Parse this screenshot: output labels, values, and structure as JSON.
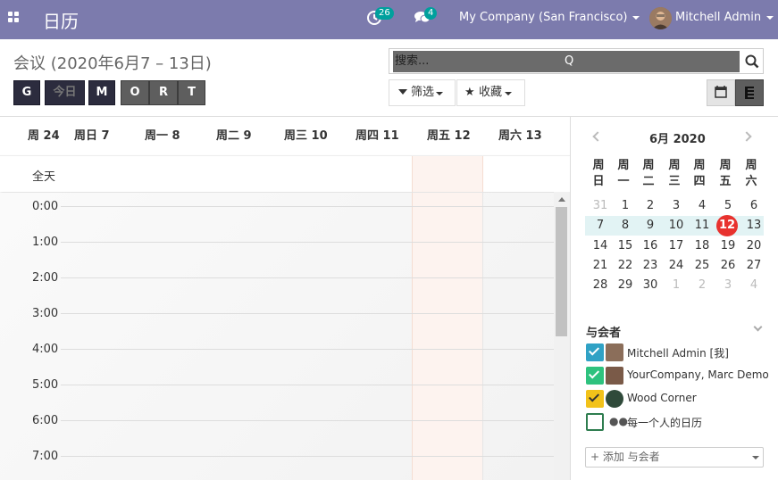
{
  "navbar": {
    "app_title": "日历",
    "activity_count": "26",
    "messages_count": "4",
    "company": "My Company (San Francisco)",
    "user": "Mitchell Admin",
    "color": "#7c7bad"
  },
  "control": {
    "breadcrumb": "会议 (2020年6月7 – 13日)",
    "nav_buttons": [
      "G",
      "今日",
      "M",
      "O",
      "R",
      "T"
    ],
    "search": {
      "placeholder": "搜索...",
      "shortcut": "Q"
    },
    "filter_label": "筛选",
    "favorites_label": "收藏"
  },
  "calendar": {
    "week_number": "周 24",
    "days": [
      "周日 7",
      "周一 8",
      "周二 9",
      "周三 10",
      "周四 11",
      "周五 12",
      "周六 13"
    ],
    "allday_label": "全天",
    "hours": [
      "0:00",
      "1:00",
      "2:00",
      "3:00",
      "4:00",
      "5:00",
      "6:00",
      "7:00"
    ],
    "today_color": "#fdf3ef"
  },
  "mini_calendar": {
    "title": "6月 2020",
    "weekdays": [
      "周\n日",
      "周\n一",
      "周\n二",
      "周\n三",
      "周\n四",
      "周\n五",
      "周\n六"
    ],
    "weeks": [
      [
        "31",
        "1",
        "2",
        "3",
        "4",
        "5",
        "6"
      ],
      [
        "7",
        "8",
        "9",
        "10",
        "11",
        "12",
        "13"
      ],
      [
        "14",
        "15",
        "16",
        "17",
        "18",
        "19",
        "20"
      ],
      [
        "21",
        "22",
        "23",
        "24",
        "25",
        "26",
        "27"
      ],
      [
        "28",
        "29",
        "30",
        "1",
        "2",
        "3",
        "4"
      ]
    ],
    "today": "12",
    "today_color": "#e8322e",
    "week_highlight_color": "#e2f3f4"
  },
  "attendees": {
    "title": "与会者",
    "items": [
      {
        "label": "Mitchell Admin [我]",
        "color": "#30a2c5",
        "checked": true
      },
      {
        "label": "YourCompany, Marc Demo",
        "color": "#2ec27e",
        "checked": true
      },
      {
        "label": "Wood Corner",
        "color": "#f2c21a",
        "checked": true
      },
      {
        "label": "每一个人的日历",
        "color": "#2e7d4f",
        "checked": false
      }
    ],
    "add_placeholder": "+ 添加 与会者"
  }
}
